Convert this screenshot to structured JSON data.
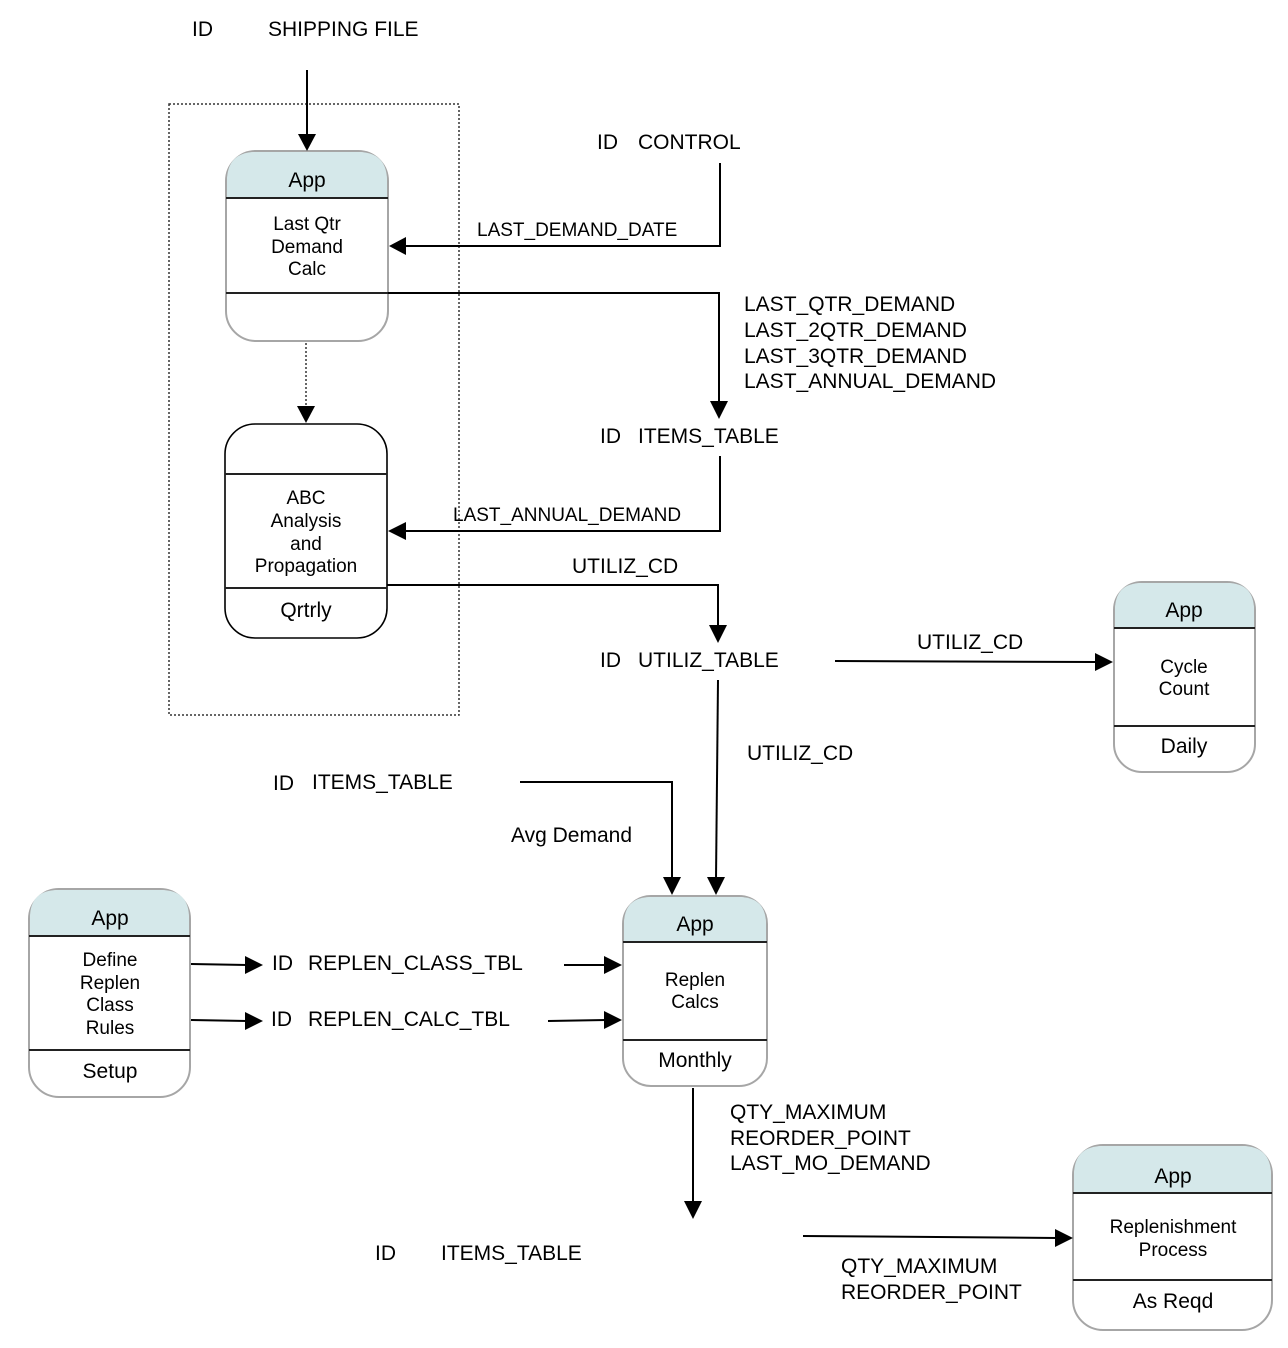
{
  "colors": {
    "app_header_fill": "#d5e8ea",
    "box_border": "#a6a6a6",
    "line": "#000000"
  },
  "data_stores": {
    "shipping_file": {
      "id": "ID",
      "name": "SHIPPING FILE"
    },
    "control": {
      "id": "ID",
      "name": "CONTROL"
    },
    "items_table_1": {
      "id": "ID",
      "name": "ITEMS_TABLE"
    },
    "utiliz_table": {
      "id": "ID",
      "name": "UTILIZ_TABLE"
    },
    "items_table_2": {
      "id": "ID",
      "name": "ITEMS_TABLE"
    },
    "replen_class_tbl": {
      "id": "ID",
      "name": "REPLEN_CLASS_TBL"
    },
    "replen_calc_tbl": {
      "id": "ID",
      "name": "REPLEN_CALC_TBL"
    },
    "items_table_3": {
      "id": "ID",
      "name": "ITEMS_TABLE"
    }
  },
  "processes": {
    "last_qtr": {
      "header": "App",
      "body": [
        "Last Qtr",
        "Demand",
        "Calc"
      ],
      "footer": ""
    },
    "abc": {
      "header": "",
      "body": [
        "ABC",
        "Analysis",
        "and",
        "Propagation"
      ],
      "footer": "Qrtrly"
    },
    "cycle_count": {
      "header": "App",
      "body": [
        "Cycle",
        "Count"
      ],
      "footer": "Daily"
    },
    "define_replen": {
      "header": "App",
      "body": [
        "Define",
        "Replen",
        "Class",
        "Rules"
      ],
      "footer": "Setup"
    },
    "replen_calcs": {
      "header": "App",
      "body": [
        "Replen",
        "Calcs"
      ],
      "footer": "Monthly"
    },
    "replenishment": {
      "header": "App",
      "body": [
        "Replenishment",
        "Process"
      ],
      "footer": "As Reqd"
    }
  },
  "flows": {
    "last_demand_date": "LAST_DEMAND_DATE",
    "demand_fields": [
      "LAST_QTR_DEMAND",
      "LAST_2QTR_DEMAND",
      "LAST_3QTR_DEMAND",
      "LAST_ANNUAL_DEMAND"
    ],
    "last_annual_demand": "LAST_ANNUAL_DEMAND",
    "utiliz_cd_1": "UTILIZ_CD",
    "utiliz_cd_2": "UTILIZ_CD",
    "utiliz_cd_3": "UTILIZ_CD",
    "avg_demand": "Avg Demand",
    "replen_outputs": [
      "QTY_MAXIMUM",
      "REORDER_POINT",
      "LAST_MO_DEMAND"
    ],
    "replen_process_inputs": [
      "QTY_MAXIMUM",
      "REORDER_POINT"
    ]
  }
}
